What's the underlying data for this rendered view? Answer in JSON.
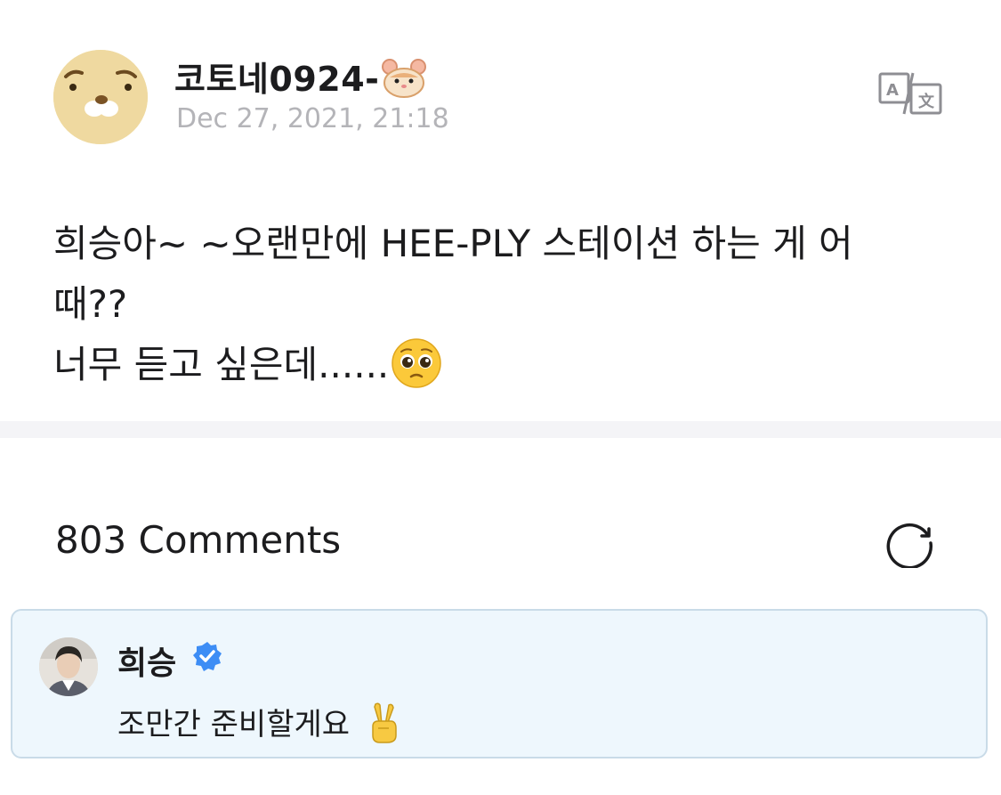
{
  "post": {
    "author_name": "코토네0924-",
    "author_emoji": "hamster-face-icon",
    "date": "Dec 27, 2021, 21:18",
    "body_lines": [
      "희승아~ ~오랜만에 HEE-PLY 스테이션 하는 게 어",
      "때??",
      "너무 듣고 싶은데......"
    ],
    "body_emoji": "pleading-face-icon",
    "translate_icon": "translate-icon"
  },
  "comments": {
    "count_label": "803 Comments",
    "refresh_icon": "refresh-icon",
    "highlighted": {
      "author": "희승",
      "verified_icon": "verified-badge-icon",
      "text": "조만간 준비할게요",
      "emoji": "victory-hand-icon"
    }
  },
  "colors": {
    "date_gray": "#b4b4b8",
    "divider": "#f4f4f7",
    "comment_bg": "#eef7fd",
    "comment_border": "#c9dbe8",
    "verified_blue": "#3d8df5"
  }
}
